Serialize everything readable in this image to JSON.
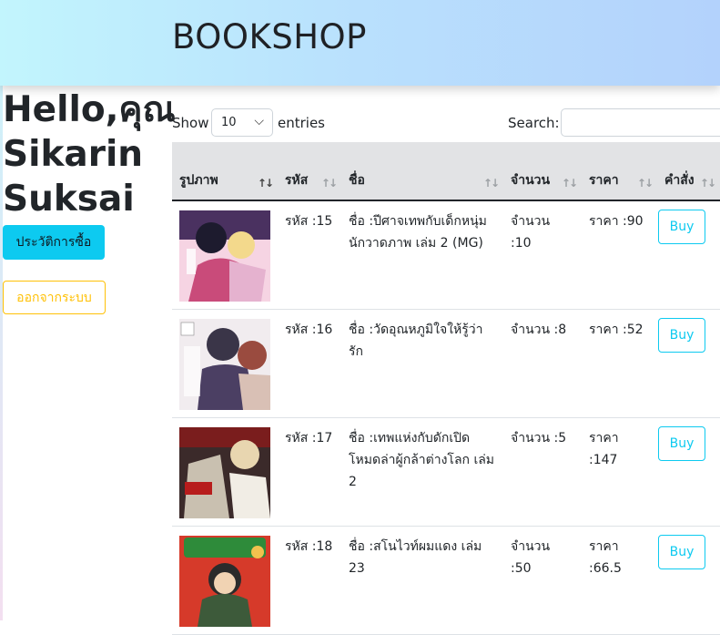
{
  "header": {
    "brand": "BOOKSHOP"
  },
  "sidebar": {
    "greeting": "Hello,คุณ Sikarin Suksai",
    "history_button": "ประวัติการซื้อ",
    "logout_button": "ออกจากระบบ"
  },
  "table_controls": {
    "show_label": "Show",
    "length_value": "10",
    "entries_label": "entries",
    "search_label": "Search:",
    "search_value": ""
  },
  "table": {
    "columns": [
      "รูปภาพ",
      "รหัส",
      "ชื่อ",
      "จำนวน",
      "ราคา",
      "คำสั่ง"
    ],
    "sort_glyph": "↑↓",
    "rows": [
      {
        "id": "รหัส :15",
        "name": "ชื่อ :ปีศาจเทพกับเด็กหนุ่มนักวาดภาพ เล่ม 2 (MG)",
        "qty": "จำนวน :10",
        "price": "ราคา :90",
        "action": "Buy"
      },
      {
        "id": "รหัส :16",
        "name": "ชื่อ :วัดอุณหภูมิใจให้รู้ว่ารัก",
        "qty": "จำนวน :8",
        "price": "ราคา :52",
        "action": "Buy"
      },
      {
        "id": "รหัส :17",
        "name": "ชื่อ :เทพแห่งกับดักเปิดโหมดล่าผู้กล้าต่างโลก เล่ม 2",
        "qty": "จำนวน :5",
        "price": "ราคา :147",
        "action": "Buy"
      },
      {
        "id": "รหัส :18",
        "name": "ชื่อ :สโนไวท์ผมแดง เล่ม 23",
        "qty": "จำนวน :50",
        "price": "ราคา :66.5",
        "action": "Buy"
      }
    ]
  },
  "colors": {
    "accent_info": "#0dcaf0",
    "accent_warning": "#ffc107",
    "header_gradient_start": "#c2f5fd",
    "header_gradient_end": "#b3d2fc"
  }
}
